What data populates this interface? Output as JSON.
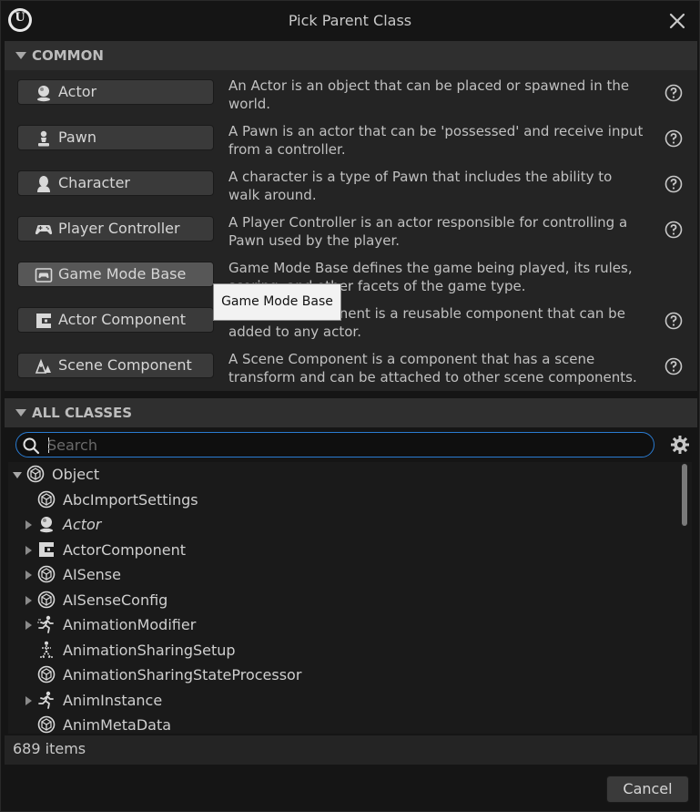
{
  "window": {
    "title": "Pick Parent Class",
    "logo_text": "U"
  },
  "common": {
    "header": "COMMON",
    "items": [
      {
        "label": "Actor",
        "icon": "actor-icon",
        "description": "An Actor is an object that can be placed or spawned in the world."
      },
      {
        "label": "Pawn",
        "icon": "pawn-icon",
        "description": "A Pawn is an actor that can be 'possessed' and receive input from a controller."
      },
      {
        "label": "Character",
        "icon": "character-icon",
        "description": "A character is a type of Pawn that includes the ability to walk around."
      },
      {
        "label": "Player Controller",
        "icon": "gamepad-icon",
        "description": "A Player Controller is an actor responsible for controlling a Pawn used by the player."
      },
      {
        "label": "Game Mode Base",
        "icon": "game-mode-icon",
        "description": "Game Mode Base defines the game being played, its rules, scoring, and other facets of the game type."
      },
      {
        "label": "Actor Component",
        "icon": "actor-component-icon",
        "description": "An Actor Component is a reusable component that can be added to any actor."
      },
      {
        "label": "Scene Component",
        "icon": "scene-component-icon",
        "description": "A Scene Component is a component that has a scene transform and can be attached to other scene components."
      }
    ],
    "tooltip": "Game Mode Base"
  },
  "all_classes": {
    "header": "ALL CLASSES",
    "search_placeholder": "Search",
    "search_value": "",
    "tree": [
      {
        "label": "Object",
        "icon": "object-icon",
        "expander": "down",
        "depth": 0,
        "italic": false
      },
      {
        "label": "AbcImportSettings",
        "icon": "object-icon",
        "expander": "none",
        "depth": 1,
        "italic": false
      },
      {
        "label": "Actor",
        "icon": "actor-icon",
        "expander": "right",
        "depth": 1,
        "italic": true
      },
      {
        "label": "ActorComponent",
        "icon": "actor-component-icon",
        "expander": "right",
        "depth": 1,
        "italic": false
      },
      {
        "label": "AISense",
        "icon": "object-icon",
        "expander": "right",
        "depth": 1,
        "italic": false
      },
      {
        "label": "AISenseConfig",
        "icon": "object-icon",
        "expander": "right",
        "depth": 1,
        "italic": false
      },
      {
        "label": "AnimationModifier",
        "icon": "running-icon",
        "expander": "right",
        "depth": 1,
        "italic": false
      },
      {
        "label": "AnimationSharingSetup",
        "icon": "skeleton-icon",
        "expander": "none",
        "depth": 1,
        "italic": false
      },
      {
        "label": "AnimationSharingStateProcessor",
        "icon": "object-icon",
        "expander": "none",
        "depth": 1,
        "italic": false
      },
      {
        "label": "AnimInstance",
        "icon": "running-icon",
        "expander": "right",
        "depth": 1,
        "italic": false
      },
      {
        "label": "AnimMetaData",
        "icon": "object-icon",
        "expander": "none",
        "depth": 1,
        "italic": false
      }
    ],
    "item_count": "689 items"
  },
  "footer": {
    "cancel_label": "Cancel"
  },
  "colors": {
    "accent": "#2a7bd1",
    "background": "#151515",
    "panel": "#242424"
  }
}
